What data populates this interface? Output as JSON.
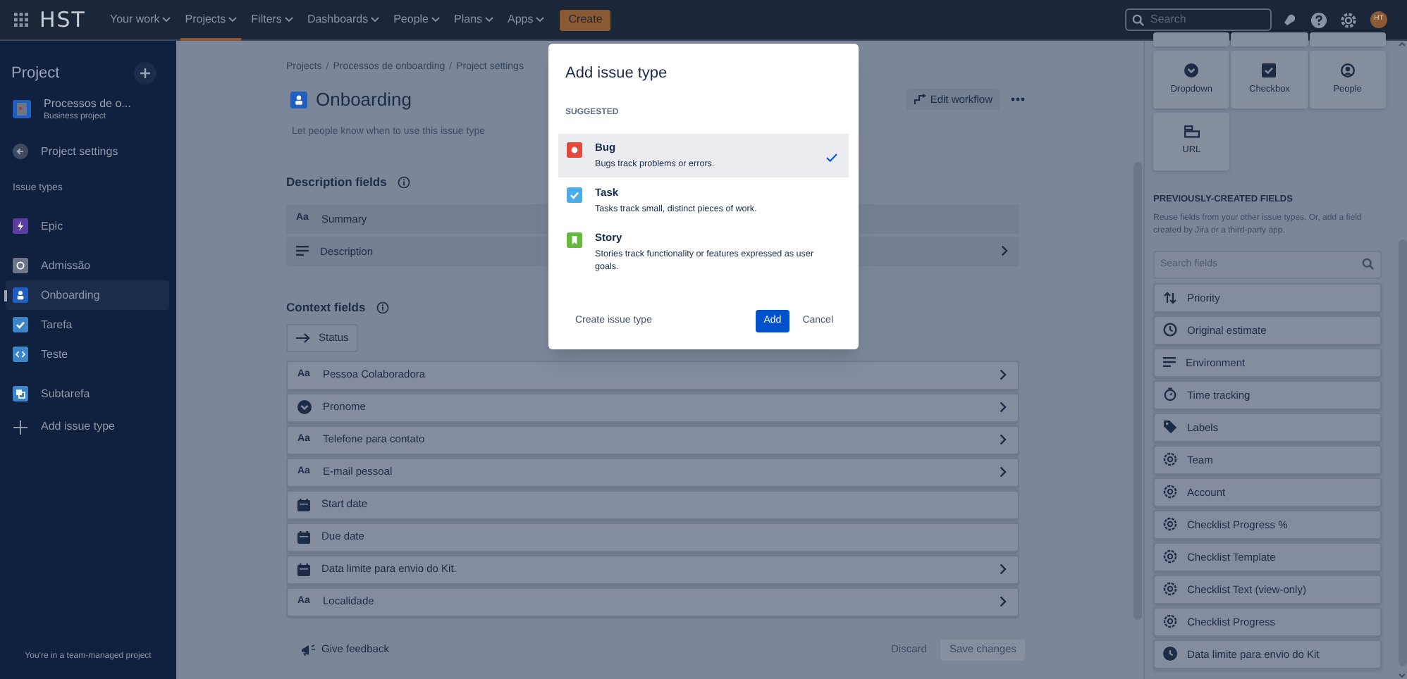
{
  "top_nav": {
    "logo": "HST",
    "menu": [
      {
        "label": "Your work",
        "selected": false
      },
      {
        "label": "Projects",
        "selected": true
      },
      {
        "label": "Filters",
        "selected": false
      },
      {
        "label": "Dashboards",
        "selected": false
      },
      {
        "label": "People",
        "selected": false
      },
      {
        "label": "Plans",
        "selected": false
      },
      {
        "label": "Apps",
        "selected": false
      }
    ],
    "create_button": "Create",
    "search": {
      "placeholder": "Search"
    },
    "avatar": "HT"
  },
  "sidebar": {
    "title": "Project",
    "project": {
      "name": "Processos de o...",
      "type": "Business project"
    },
    "settings_link": "Project settings",
    "section_label": "Issue types",
    "issue_type_groups": [
      [
        {
          "label": "Epic",
          "kind": "epic",
          "color": "#5b3fa0",
          "selected": false
        }
      ],
      [
        {
          "label": "Admissão",
          "kind": "generic",
          "color": "#6c7589",
          "selected": false
        },
        {
          "label": "Onboarding",
          "kind": "person",
          "color": "#1f5fc0",
          "selected": true
        },
        {
          "label": "Tarefa",
          "kind": "task",
          "color": "#3a86c8",
          "selected": false
        },
        {
          "label": "Teste",
          "kind": "code",
          "color": "#3a86c8",
          "selected": false
        }
      ],
      [
        {
          "label": "Subtarefa",
          "kind": "subtask",
          "color": "#3a86c8",
          "selected": false
        }
      ]
    ],
    "add_label": "Add issue type",
    "footer": "You're in a team-managed project"
  },
  "main": {
    "breadcrumbs": [
      {
        "kind": "link",
        "label": "Projects"
      },
      {
        "kind": "separator",
        "label": "/"
      },
      {
        "kind": "link",
        "label": "Processos de onboarding"
      },
      {
        "kind": "separator",
        "label": "/"
      },
      {
        "kind": "link",
        "label": "Project settings"
      }
    ],
    "title": "Onboarding",
    "edit_workflow": "Edit workflow",
    "description_hint": "Let people know when to use this issue type",
    "description_fields": {
      "heading": "Description fields",
      "rows": [
        {
          "label": "Summary",
          "kind": "text",
          "glyph": "Aa",
          "expandable": false
        },
        {
          "label": "Description",
          "kind": "paragraph",
          "expandable": true
        }
      ]
    },
    "context_fields": {
      "heading": "Context fields",
      "status_chip": "Status",
      "rows": [
        {
          "label": "Pessoa Colaboradora",
          "kind": "text",
          "glyph": "Aa",
          "expandable": true
        },
        {
          "label": "Pronome",
          "kind": "dropdown",
          "expandable": true
        },
        {
          "label": "Telefone para contato",
          "kind": "text",
          "glyph": "Aa",
          "expandable": true
        },
        {
          "label": "E-mail pessoal",
          "kind": "text",
          "glyph": "Aa",
          "expandable": true
        },
        {
          "label": "Start date",
          "kind": "date",
          "expandable": false
        },
        {
          "label": "Due date",
          "kind": "date",
          "expandable": false
        },
        {
          "label": "Data limite para envio do Kit.",
          "kind": "date",
          "expandable": true
        },
        {
          "label": "Localidade",
          "kind": "text",
          "glyph": "Aa",
          "expandable": true
        }
      ]
    },
    "give_feedback": "Give feedback",
    "discard": "Discard",
    "save_changes": {
      "label": "Save changes",
      "disabled": true
    }
  },
  "right_panel": {
    "field_types": [
      {
        "label": "Dropdown",
        "kind": "dropdown"
      },
      {
        "label": "Checkbox",
        "kind": "checkbox"
      },
      {
        "label": "People",
        "kind": "people"
      },
      {
        "label": "URL",
        "kind": "url"
      }
    ],
    "heading": "PREVIOUSLY-CREATED FIELDS",
    "description": "Reuse fields from your other issue types. Or, add a field created by Jira or a third-party app.",
    "search": {
      "placeholder": "Search fields"
    },
    "fields": [
      {
        "label": "Priority",
        "kind": "priority"
      },
      {
        "label": "Original estimate",
        "kind": "clock"
      },
      {
        "label": "Environment",
        "kind": "lines"
      },
      {
        "label": "Time tracking",
        "kind": "timer"
      },
      {
        "label": "Labels",
        "kind": "tag"
      },
      {
        "label": "Team",
        "kind": "gear"
      },
      {
        "label": "Account",
        "kind": "gear"
      },
      {
        "label": "Checklist Progress %",
        "kind": "gear"
      },
      {
        "label": "Checklist Template",
        "kind": "gear"
      },
      {
        "label": "Checklist Text (view-only)",
        "kind": "gear"
      },
      {
        "label": "Checklist Progress",
        "kind": "gear"
      },
      {
        "label": "Data limite para envio do Kit",
        "kind": "clock_solid"
      }
    ]
  },
  "modal": {
    "title": "Add issue type",
    "section": "SUGGESTED",
    "options": [
      {
        "kind": "bug",
        "name": "Bug",
        "description": "Bugs track problems or errors.",
        "selected": true
      },
      {
        "kind": "task",
        "name": "Task",
        "description": "Tasks track small, distinct pieces of work.",
        "selected": false
      },
      {
        "kind": "story",
        "name": "Story",
        "description": "Stories track functionality or features expressed as user goals.",
        "selected": false
      }
    ],
    "create_link": "Create issue type",
    "add_button": "Add",
    "cancel_button": "Cancel"
  }
}
